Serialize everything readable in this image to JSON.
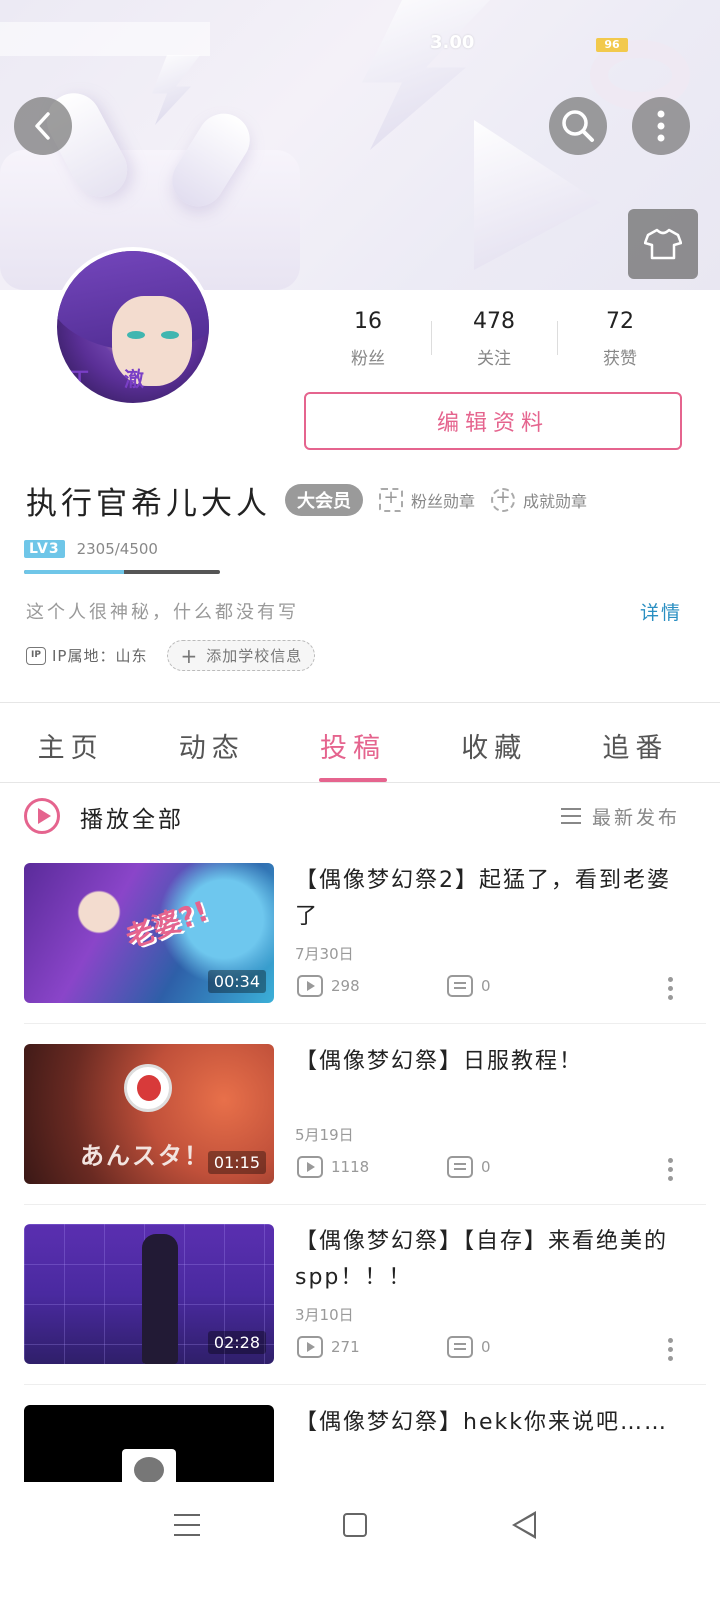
{
  "status_bar": {
    "speed": "3.00",
    "battery": "96"
  },
  "header": {
    "back_icon": "chevron-left-icon",
    "search_icon": "search-icon",
    "more_icon": "more-vertical-icon",
    "theme_icon": "tshirt-icon"
  },
  "profile": {
    "avatar_tag": "丁 澈 宝",
    "stats": [
      {
        "value": "16",
        "label": "粉丝"
      },
      {
        "value": "478",
        "label": "关注"
      },
      {
        "value": "72",
        "label": "获赞"
      }
    ],
    "edit_label": "编辑资料",
    "name": "执行官希儿大人",
    "vip_label": "大会员",
    "fan_medal_label": "粉丝勋章",
    "achievement_label": "成就勋章",
    "level_label": "LV3",
    "exp_text": "2305/4500",
    "exp_progress": 0.512,
    "bio": "这个人很神秘，什么都没有写",
    "detail_label": "详情",
    "ip_icon": "IP",
    "ip_text": "IP属地：山东",
    "add_school_label": "添加学校信息"
  },
  "tabs": [
    {
      "label": "主页",
      "active": false
    },
    {
      "label": "动态",
      "active": false
    },
    {
      "label": "投稿",
      "active": true
    },
    {
      "label": "收藏",
      "active": false
    },
    {
      "label": "追番",
      "active": false
    }
  ],
  "list_header": {
    "play_all": "播放全部",
    "sort": "最新发布"
  },
  "videos": [
    {
      "title": "【偶像梦幻祭2】起猛了，看到老婆了",
      "date": "7月30日",
      "views": "298",
      "comments": "0",
      "duration": "00:34",
      "sticker": "老婆?!"
    },
    {
      "title": "【偶像梦幻祭】日服教程！",
      "date": "5月19日",
      "views": "1118",
      "comments": "0",
      "duration": "01:15",
      "thumb_text": "あんスタ！"
    },
    {
      "title": "【偶像梦幻祭】【自存】来看绝美的spp！！！",
      "date": "3月10日",
      "views": "271",
      "comments": "0",
      "duration": "02:28"
    },
    {
      "title": "【偶像梦幻祭】hekk你来说吧……",
      "date": "",
      "views": "",
      "comments": "",
      "duration": ""
    }
  ],
  "nav": {
    "menu_icon": "menu-icon",
    "home_icon": "home-square-icon",
    "back_icon": "back-triangle-icon"
  },
  "colors": {
    "accent": "#e5648e",
    "link": "#2a8fc2",
    "level": "#6fc6e8"
  }
}
